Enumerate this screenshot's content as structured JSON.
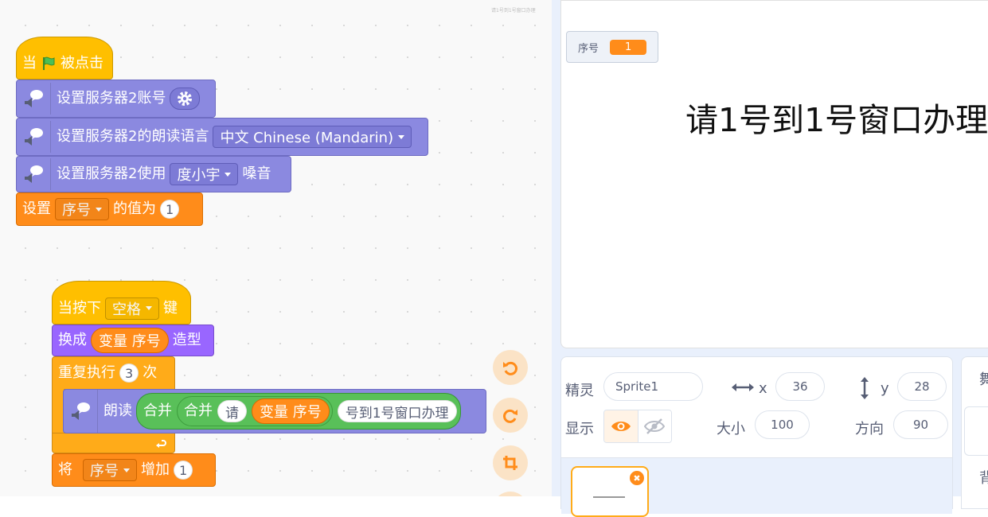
{
  "workspace": {
    "tiny_caption": "请1号到1号窗口办理",
    "script1": {
      "hat_when": "当",
      "hat_clicked": "被点击",
      "set_account": "设置服务器2账号",
      "set_language": "设置服务器2的朗读语言",
      "language_value": "中文 Chinese (Mandarin)",
      "set_voice": "设置服务器2使用",
      "voice_value": "度小宇",
      "voice_suffix": "嗓音",
      "set_var": "设置",
      "var_name": "序号",
      "set_var_mid": "的值为",
      "set_var_value": "1"
    },
    "script2": {
      "hat_press": "当按下",
      "key_value": "空格",
      "hat_key": "键",
      "switch_costume": "换成",
      "costume_reporter": "变量 序号",
      "costume_suffix": "造型",
      "repeat": "重复执行",
      "repeat_count": "3",
      "repeat_suffix": "次",
      "speak": "朗读",
      "join_outer": "合并",
      "join_inner": "合并",
      "join_text_1": "请",
      "join_reporter": "变量 序号",
      "join_text_2": "号到1号窗口办理",
      "change": "将",
      "change_var": "序号",
      "change_mid": "增加",
      "change_value": "1"
    }
  },
  "stage": {
    "monitor_label": "序号",
    "monitor_value": "1",
    "say_text": "请1号到1号窗口办理"
  },
  "sprite_info": {
    "sprite_label": "精灵",
    "sprite_name": "Sprite1",
    "x_label": "x",
    "x_value": "36",
    "y_label": "y",
    "y_value": "28",
    "show_label": "显示",
    "size_label": "大小",
    "size_value": "100",
    "direction_label": "方向",
    "direction_value": "90"
  },
  "backdrop_pane": {
    "top_char": "舞",
    "bottom_char": "背"
  },
  "colors": {
    "event": "#ffbf00",
    "tts": "#8b89e0",
    "looks": "#9966ff",
    "control": "#ffab19",
    "data": "#ff8c1a",
    "operators": "#59c059"
  }
}
